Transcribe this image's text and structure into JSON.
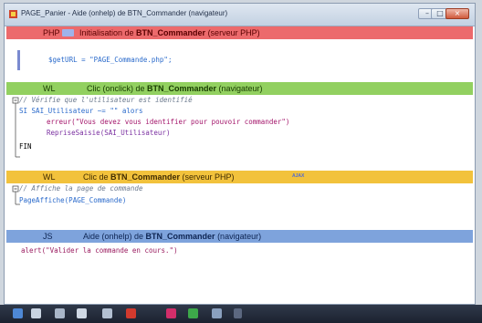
{
  "window": {
    "title": "PAGE_Panier - Aide (onhelp) de BTN_Commander (navigateur)"
  },
  "sections": [
    {
      "lang": "PHP",
      "event_prefix": "Initialisation de ",
      "event_target": "BTN_Commander",
      "event_suffix": " (serveur PHP)",
      "color": "#e8696a",
      "code": [
        "$getURL = \"PAGE_Commande.php\";"
      ]
    },
    {
      "lang": "WL",
      "event_prefix": "Clic (onclick) de ",
      "event_target": "BTN_Commander",
      "event_suffix": " (navigateur)",
      "color": "#8fcf5d",
      "code": [
        "// Vérifie que l'utilisateur est identifié",
        "SI SAI_Utilisateur ~= \"\" alors",
        "erreur(\"Vous devez vous identifier pour pouvoir commander\")",
        "RepriseSaisie(SAI_Utilisateur)",
        "FIN"
      ]
    },
    {
      "lang": "WL",
      "event_prefix": "Clic de ",
      "event_target": "BTN_Commander",
      "event_suffix": " (serveur PHP)",
      "badge": "AJAX",
      "color": "#f2c23c",
      "code": [
        "// Affiche la page de commande",
        "PageAffiche(PAGE_Commande)"
      ]
    },
    {
      "lang": "JS",
      "event_prefix": "Aide (onhelp) de ",
      "event_target": "BTN_Commander",
      "event_suffix": " (navigateur)",
      "color": "#7aa0d8",
      "code": [
        "alert(\"Valider la commande en cours.\")"
      ]
    }
  ],
  "taskbar": {
    "icons": [
      "windev-icon",
      "folder-icon",
      "tool-icon",
      "gear-icon",
      "doc-icon",
      "red-app-icon",
      "green-app-icon",
      "chart-icon",
      "more-icon"
    ]
  }
}
